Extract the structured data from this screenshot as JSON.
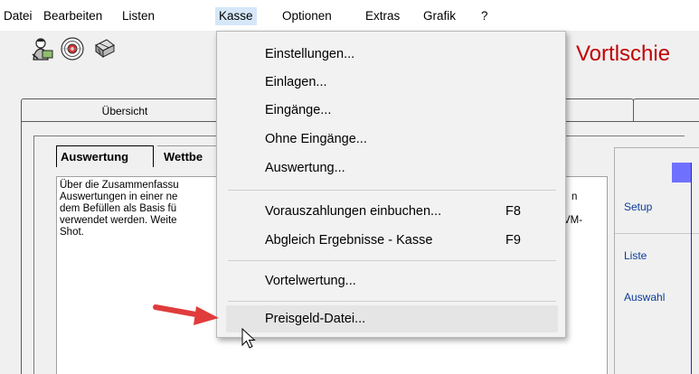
{
  "menubar": {
    "items": [
      "Datei",
      "Bearbeiten",
      "Listen",
      "Kasse",
      "Optionen",
      "Extras",
      "Grafik",
      "?"
    ],
    "active_index": 3
  },
  "toolbar": {
    "buttons": [
      {
        "icon": "person-cash-icon"
      },
      {
        "icon": "target-icon"
      },
      {
        "icon": "cash-bundle-icon"
      }
    ],
    "brand": "Vortlschie"
  },
  "outer_tabs": {
    "active_label": "Übersicht"
  },
  "inner_tabs": [
    "Auswertung",
    "Wettbe"
  ],
  "textbox": {
    "lines": [
      "Über die Zusammenfassu",
      "Auswertungen in einer ne",
      "dem Befüllen als Basis fü",
      "verwendet werden. Weite",
      "Shot."
    ],
    "lines_right": [
      "",
      "n",
      "",
      "VM-",
      ""
    ]
  },
  "right_panel": {
    "labels": [
      "Setup",
      "Liste",
      "Auswahl"
    ]
  },
  "dropdown": {
    "items": [
      {
        "label": "Einstellungen...",
        "shortcut": ""
      },
      {
        "label": "Einlagen...",
        "shortcut": ""
      },
      {
        "label": "Eingänge...",
        "shortcut": ""
      },
      {
        "label": "Ohne Eingänge...",
        "shortcut": ""
      },
      {
        "label": "Auswertung...",
        "shortcut": ""
      },
      {
        "label": "Vorauszahlungen einbuchen...",
        "shortcut": "F8"
      },
      {
        "label": "Abgleich Ergebnisse - Kasse",
        "shortcut": "F9"
      },
      {
        "label": "Vortelwertung...",
        "shortcut": ""
      },
      {
        "label": "Preisgeld-Datei...",
        "shortcut": ""
      }
    ],
    "highlighted_index": 8
  },
  "colors": {
    "brand_red": "#c00000",
    "arrow_red": "#e03c3c",
    "panel_label_blue": "#0b3c9a",
    "menu_active": "#d5e7f8"
  }
}
